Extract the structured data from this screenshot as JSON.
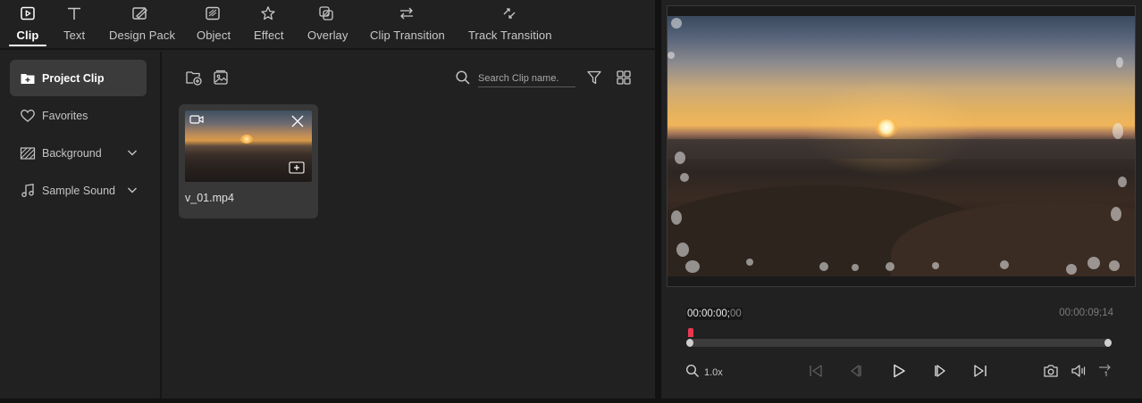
{
  "tabs": [
    {
      "label": "Clip",
      "icon": "clip-icon",
      "active": true
    },
    {
      "label": "Text",
      "icon": "text-icon"
    },
    {
      "label": "Design Pack",
      "icon": "design-pack-icon"
    },
    {
      "label": "Object",
      "icon": "object-icon"
    },
    {
      "label": "Effect",
      "icon": "effect-icon"
    },
    {
      "label": "Overlay",
      "icon": "overlay-icon"
    },
    {
      "label": "Clip Transition",
      "icon": "clip-transition-icon"
    },
    {
      "label": "Track Transition",
      "icon": "track-transition-icon"
    }
  ],
  "sidebar": {
    "items": [
      {
        "label": "Project Clip",
        "icon": "folder-plus-icon",
        "active": true
      },
      {
        "label": "Favorites",
        "icon": "heart-icon"
      },
      {
        "label": "Background",
        "icon": "hatch-icon",
        "expandable": true
      },
      {
        "label": "Sample Sound",
        "icon": "music-note-icon",
        "expandable": true
      }
    ]
  },
  "toolbar": {
    "search": {
      "placeholder": "Search Clip name."
    }
  },
  "clips": [
    {
      "name": "v_01.mp4",
      "type_icon": "video-camera-icon"
    }
  ],
  "player": {
    "current_time_main": "00:00:00;",
    "current_time_frames": "00",
    "end_time": "00:00:09;14",
    "zoom": "1.0x",
    "progress": 0
  },
  "colors": {
    "accent": "#ffffff",
    "playhead": "#e8384f",
    "panel": "#212121",
    "active_item": "#3b3b3b"
  }
}
